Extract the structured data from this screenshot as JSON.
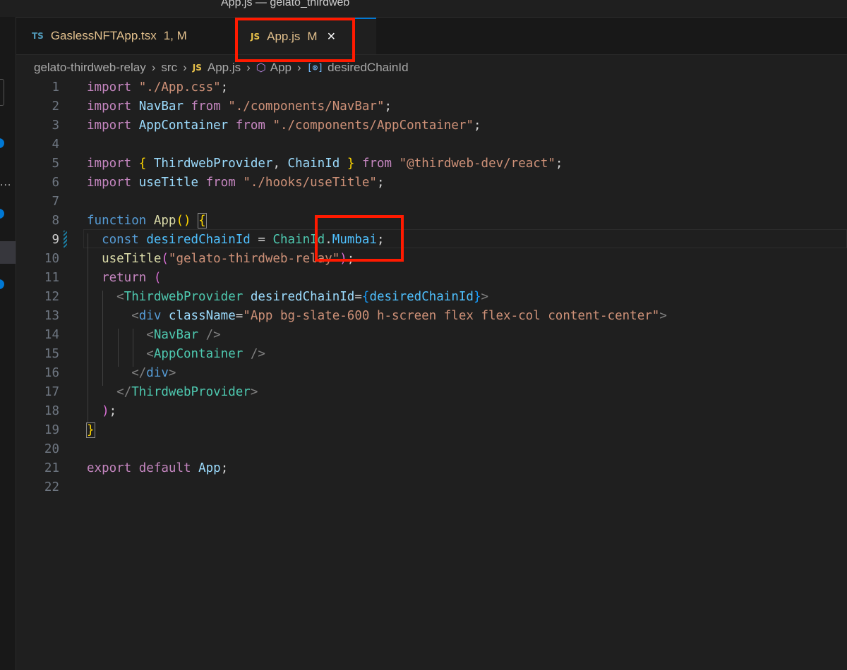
{
  "window": {
    "title": "App.js — gelato_thirdweb"
  },
  "tabs": [
    {
      "lang": "TS",
      "name": "GaslessNFTApp.tsx",
      "status": "1, M"
    },
    {
      "lang": "JS",
      "name": "App.js",
      "status": "M",
      "close": "×"
    }
  ],
  "breadcrumb": {
    "folder": "gelato-thirdweb-relay",
    "src": "src",
    "file_lang": "JS",
    "file": "App.js",
    "symbol": "App",
    "variable_icon": "[⊗]",
    "variable": "desiredChainId"
  },
  "sidebar": {
    "ellipsis": "..."
  },
  "editor": {
    "line_numbers": [
      "1",
      "2",
      "3",
      "4",
      "5",
      "6",
      "7",
      "8",
      "9",
      "10",
      "11",
      "12",
      "13",
      "14",
      "15",
      "16",
      "17",
      "18",
      "19",
      "20",
      "21",
      "22"
    ],
    "active_line": "9"
  },
  "colors": {
    "highlight_box": "#ff1a00",
    "accent": "#0078d4",
    "background": "#1f1f1f"
  },
  "icons": {
    "tab_close": "close-icon",
    "breadcrumb_symbol": "cube-icon",
    "breadcrumb_variable": "variable-icon",
    "breadcrumb_separator": "chevron-right-icon"
  }
}
